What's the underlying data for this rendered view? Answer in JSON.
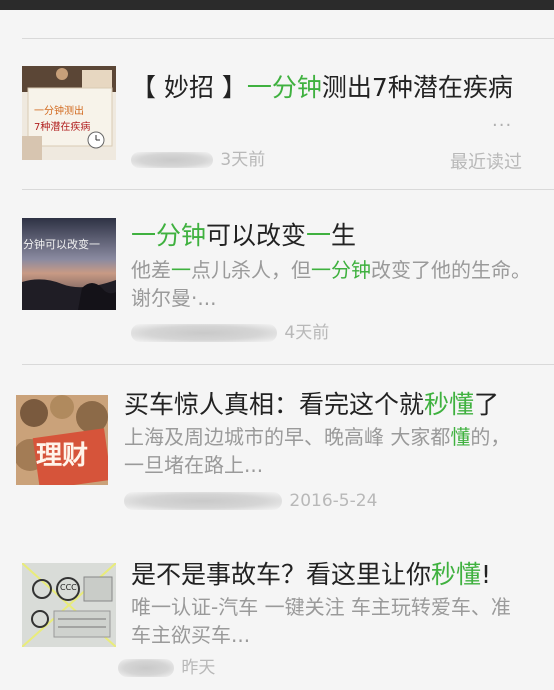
{
  "articles": [
    {
      "title_parts": [
        "【 妙招 】",
        "一分钟",
        "测出7种潜在疾病"
      ],
      "summary": "...",
      "source_blur": "",
      "time": "3天前",
      "read_state": "最近读过",
      "thumb_caption_1": "一分钟测出",
      "thumb_caption_2": "7种潜在疾病"
    },
    {
      "title_parts": [
        "一分钟",
        "可以改变",
        "一",
        "生"
      ],
      "summary_parts": [
        "他差",
        "一",
        "点儿杀人，但",
        "一分钟",
        "改变了他的生命。谢尔曼·..."
      ],
      "time": "4天前",
      "thumb_caption": "分钟可以改变一"
    },
    {
      "title_parts": [
        "买车惊人真相：看完这个就",
        "秒懂",
        "了"
      ],
      "summary_parts": [
        "上海及周边城市的早、晚高峰 大家都",
        "懂",
        "的，一旦堵在路上..."
      ],
      "time": "2016-5-24",
      "thumb_caption": "理财"
    },
    {
      "title_parts": [
        "是不是事故车？看这里让你",
        "秒懂",
        "!"
      ],
      "summary": "唯一认证-汽车 一键关注 车主玩转爱车、准车主欲买车...",
      "time": "昨天",
      "thumb_caption": "CCC"
    }
  ],
  "colors": {
    "highlight": "#3fb13f",
    "title": "#222222",
    "summary": "#9a9a9a",
    "meta": "#b8b8b8"
  }
}
